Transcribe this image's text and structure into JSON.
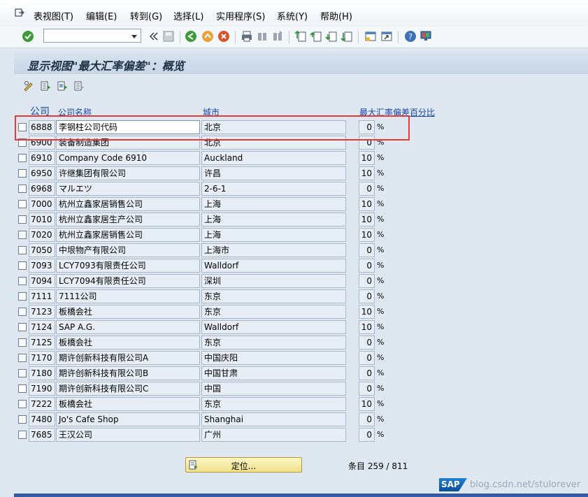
{
  "menubar": {
    "items": [
      "表视图(T)",
      "编辑(E)",
      "转到(G)",
      "选择(L)",
      "实用程序(S)",
      "系统(Y)",
      "帮助(H)"
    ]
  },
  "toolbar": {
    "command_value": "",
    "icons": [
      "enter-icon",
      "save-icon",
      "back-icon",
      "exit-icon",
      "cancel-icon",
      "print-icon",
      "find-icon",
      "find-next-icon",
      "first-page-icon",
      "prev-page-icon",
      "next-page-icon",
      "last-page-icon",
      "create-session-icon",
      "shortcut-icon",
      "help-icon",
      "customize-layout-icon"
    ]
  },
  "title": "显示视图\"最大汇率偏差\"：概览",
  "table": {
    "headers": {
      "code": "公司",
      "name": "公司名称",
      "city": "城市",
      "pct": "最大汇率偏差百分比"
    },
    "percent_sign": "%",
    "rows": [
      {
        "code": "6888",
        "name": "李钢柱公司代码",
        "city": "北京",
        "pct": "0"
      },
      {
        "code": "6900",
        "name": "装备制造集团",
        "city": "北京",
        "pct": "0"
      },
      {
        "code": "6910",
        "name": "Company Code 6910",
        "city": "Auckland",
        "pct": "10"
      },
      {
        "code": "6950",
        "name": "许继集团有限公司",
        "city": "许昌",
        "pct": "10"
      },
      {
        "code": "6968",
        "name": "マルエツ",
        "city": "2-6-1",
        "pct": "0"
      },
      {
        "code": "7000",
        "name": "杭州立鑫家居销售公司",
        "city": "上海",
        "pct": "10"
      },
      {
        "code": "7010",
        "name": "杭州立鑫家居生产公司",
        "city": "上海",
        "pct": "10"
      },
      {
        "code": "7020",
        "name": "杭州立鑫家居销售公司",
        "city": "上海",
        "pct": "10"
      },
      {
        "code": "7050",
        "name": "中垠物产有限公司",
        "city": "上海市",
        "pct": "0"
      },
      {
        "code": "7093",
        "name": "LCY7093有限责任公司",
        "city": "Walldorf",
        "pct": "0"
      },
      {
        "code": "7094",
        "name": "LCY7094有限责任公司",
        "city": "深圳",
        "pct": "0"
      },
      {
        "code": "7111",
        "name": "7111公司",
        "city": "东京",
        "pct": "0"
      },
      {
        "code": "7123",
        "name": "板橋会社",
        "city": "东京",
        "pct": "10"
      },
      {
        "code": "7124",
        "name": "SAP A.G.",
        "city": "Walldorf",
        "pct": "10"
      },
      {
        "code": "7125",
        "name": "板橋会社",
        "city": "东京",
        "pct": "0"
      },
      {
        "code": "7170",
        "name": "期许创新科技有限公司A",
        "city": "中国庆阳",
        "pct": "0"
      },
      {
        "code": "7180",
        "name": "期许创新科技有限公司B",
        "city": "中国甘肃",
        "pct": "0"
      },
      {
        "code": "7190",
        "name": "期许创新科技有限公司C",
        "city": "中国",
        "pct": "0"
      },
      {
        "code": "7222",
        "name": "板橋会社",
        "city": "东京",
        "pct": "10"
      },
      {
        "code": "7480",
        "name": "Jo's Cafe Shop",
        "city": "Shanghai",
        "pct": "0"
      },
      {
        "code": "7685",
        "name": "王汉公司",
        "city": "广州",
        "pct": "0"
      }
    ]
  },
  "footer": {
    "locate_label": "定位...",
    "entry_info": "条目 259 / 811",
    "logo_text": "SAP",
    "watermark": "blog.csdn.net/stulorever"
  },
  "colors": {
    "header_link": "#1446a8",
    "highlight": "#e23b3b"
  }
}
